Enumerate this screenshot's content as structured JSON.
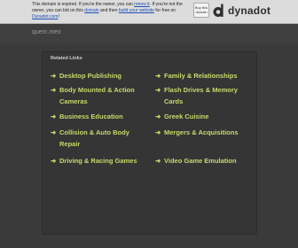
{
  "notice": {
    "text_before_renew": "This domain is expired. If you're the owner, you can ",
    "renew_link": "renew it",
    "text_between": ". If you're not the owner, you can bid on this ",
    "domain_link": "domain",
    "text_before_build": " and then ",
    "build_link": "build your website",
    "text_before_site": " for free on ",
    "site_link": "Dynadot.com",
    "text_end": "!"
  },
  "buy_button": "Buy this domain",
  "brand": {
    "name": "dynadot",
    "icon": "dynadot-logo-icon"
  },
  "domain_title": "quem.mex",
  "related": {
    "heading": "Related Links",
    "left": [
      "Desktop Publishing",
      "Body Mounted & Action Cameras",
      "Business Education",
      "Collision & Auto Body Repair",
      "Driving & Racing Games"
    ],
    "right": [
      "Family & Relationships",
      "Flash Drives & Memory Cards",
      "Greek Cuisine",
      "Mergers & Acquisitions",
      "Video Game Emulation"
    ],
    "arrow": "➜"
  },
  "colors": {
    "background": "#3a3a3a",
    "link": "#c8d96a",
    "bar": "#dcdcdc"
  }
}
